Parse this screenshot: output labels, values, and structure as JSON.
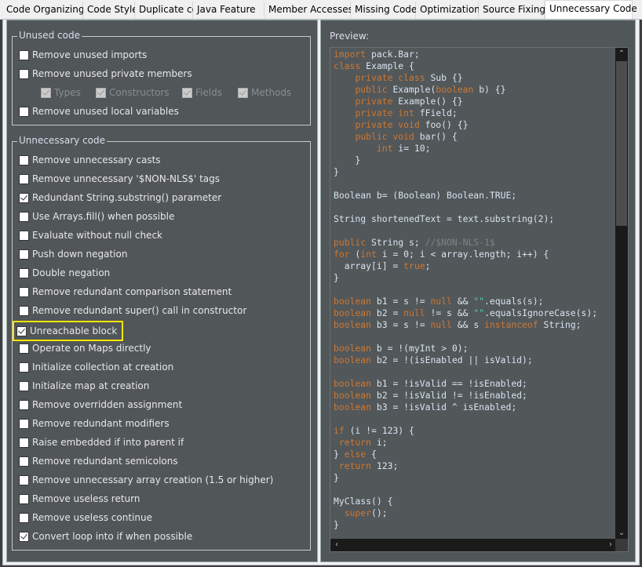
{
  "tabs": [
    {
      "label": "Code Organizing",
      "active": false
    },
    {
      "label": "Code Style",
      "active": false
    },
    {
      "label": "Duplicate code",
      "active": false
    },
    {
      "label": "Java Feature",
      "active": false
    },
    {
      "label": "Member Accesses",
      "active": false
    },
    {
      "label": "Missing Code",
      "active": false
    },
    {
      "label": "Optimization",
      "active": false
    },
    {
      "label": "Source Fixing",
      "active": false
    },
    {
      "label": "Unnecessary Code",
      "active": true
    }
  ],
  "unused_code": {
    "title": "Unused code",
    "options": [
      {
        "label": "Remove unused imports",
        "checked": false
      },
      {
        "label": "Remove unused private members",
        "checked": false
      }
    ],
    "sub_options": [
      {
        "label": "Types",
        "checked": true,
        "disabled": true
      },
      {
        "label": "Constructors",
        "checked": true,
        "disabled": true
      },
      {
        "label": "Fields",
        "checked": true,
        "disabled": true
      },
      {
        "label": "Methods",
        "checked": true,
        "disabled": true
      }
    ],
    "last_option": {
      "label": "Remove unused local variables",
      "checked": false
    }
  },
  "unnecessary_code": {
    "title": "Unnecessary code",
    "options": [
      {
        "label": "Remove unnecessary casts",
        "checked": false
      },
      {
        "label": "Remove unnecessary '$NON-NLS$' tags",
        "checked": false
      },
      {
        "label": "Redundant String.substring() parameter",
        "checked": true
      },
      {
        "label": "Use Arrays.fill() when possible",
        "checked": false
      },
      {
        "label": "Evaluate without null check",
        "checked": false
      },
      {
        "label": "Push down negation",
        "checked": false
      },
      {
        "label": "Double negation",
        "checked": false
      },
      {
        "label": "Remove redundant comparison statement",
        "checked": false
      },
      {
        "label": "Remove redundant super() call in constructor",
        "checked": false
      },
      {
        "label": "Unreachable block",
        "checked": true,
        "highlighted": true
      },
      {
        "label": "Operate on Maps directly",
        "checked": false
      },
      {
        "label": "Initialize collection at creation",
        "checked": false
      },
      {
        "label": "Initialize map at creation",
        "checked": false
      },
      {
        "label": "Remove overridden assignment",
        "checked": false
      },
      {
        "label": "Remove redundant modifiers",
        "checked": false
      },
      {
        "label": "Raise embedded if into parent if",
        "checked": false
      },
      {
        "label": "Remove redundant semicolons",
        "checked": false
      },
      {
        "label": "Remove unnecessary array creation (1.5 or higher)",
        "checked": false
      },
      {
        "label": "Remove useless return",
        "checked": false
      },
      {
        "label": "Remove useless continue",
        "checked": false
      },
      {
        "label": "Convert loop into if when possible",
        "checked": true
      }
    ]
  },
  "preview": {
    "label": "Preview:",
    "colors": {
      "keyword": "#cc7832",
      "text": "#d8e4f0",
      "comment": "#7f8385",
      "string": "#4ec9b0",
      "highlight": "#ffe600"
    },
    "lines": [
      [
        [
          "k",
          "import"
        ],
        [
          "t",
          " pack.Bar;"
        ]
      ],
      [
        [
          "k",
          "class"
        ],
        [
          "t",
          " Example {"
        ]
      ],
      [
        [
          "t",
          "    "
        ],
        [
          "k",
          "private class"
        ],
        [
          "t",
          " Sub {}"
        ]
      ],
      [
        [
          "t",
          "    "
        ],
        [
          "k",
          "public"
        ],
        [
          "t",
          " Example("
        ],
        [
          "k",
          "boolean"
        ],
        [
          "t",
          " b) {}"
        ]
      ],
      [
        [
          "t",
          "    "
        ],
        [
          "k",
          "private"
        ],
        [
          "t",
          " Example() {}"
        ]
      ],
      [
        [
          "t",
          "    "
        ],
        [
          "k",
          "private int"
        ],
        [
          "t",
          " fField;"
        ]
      ],
      [
        [
          "t",
          "    "
        ],
        [
          "k",
          "private void"
        ],
        [
          "t",
          " foo() {}"
        ]
      ],
      [
        [
          "t",
          "    "
        ],
        [
          "k",
          "public void"
        ],
        [
          "t",
          " bar() {"
        ]
      ],
      [
        [
          "t",
          "        "
        ],
        [
          "k",
          "int"
        ],
        [
          "t",
          " i= 10;"
        ]
      ],
      [
        [
          "t",
          "    }"
        ]
      ],
      [
        [
          "t",
          "}"
        ]
      ],
      [],
      [
        [
          "t",
          "Boolean b= (Boolean) Boolean.TRUE;"
        ]
      ],
      [],
      [
        [
          "t",
          "String shortenedText = text.substring(2);"
        ]
      ],
      [],
      [
        [
          "k",
          "public"
        ],
        [
          "t",
          " String s; "
        ],
        [
          "c",
          "//$NON-NLS-1$"
        ]
      ],
      [
        [
          "k",
          "for"
        ],
        [
          "t",
          " ("
        ],
        [
          "k",
          "int"
        ],
        [
          "t",
          " i = 0; i < array.length; i++) {"
        ]
      ],
      [
        [
          "t",
          "  array[i] = "
        ],
        [
          "k",
          "true"
        ],
        [
          "t",
          ";"
        ]
      ],
      [
        [
          "t",
          "}"
        ]
      ],
      [],
      [
        [
          "k",
          "boolean"
        ],
        [
          "t",
          " b1 = s != "
        ],
        [
          "k",
          "null"
        ],
        [
          "t",
          " && "
        ],
        [
          "s",
          "\"\""
        ],
        [
          "t",
          ".equals(s);"
        ]
      ],
      [
        [
          "k",
          "boolean"
        ],
        [
          "t",
          " b2 = "
        ],
        [
          "k",
          "null"
        ],
        [
          "t",
          " != s && "
        ],
        [
          "s",
          "\"\""
        ],
        [
          "t",
          ".equalsIgnoreCase(s);"
        ]
      ],
      [
        [
          "k",
          "boolean"
        ],
        [
          "t",
          " b3 = s != "
        ],
        [
          "k",
          "null"
        ],
        [
          "t",
          " && s "
        ],
        [
          "k",
          "instanceof"
        ],
        [
          "t",
          " String;"
        ]
      ],
      [],
      [
        [
          "k",
          "boolean"
        ],
        [
          "t",
          " b = !(myInt > 0);"
        ]
      ],
      [
        [
          "k",
          "boolean"
        ],
        [
          "t",
          " b2 = !(isEnabled || isValid);"
        ]
      ],
      [],
      [
        [
          "k",
          "boolean"
        ],
        [
          "t",
          " b1 = !isValid == !isEnabled;"
        ]
      ],
      [
        [
          "k",
          "boolean"
        ],
        [
          "t",
          " b2 = !isValid != !isEnabled;"
        ]
      ],
      [
        [
          "k",
          "boolean"
        ],
        [
          "t",
          " b3 = !isValid ^ isEnabled;"
        ]
      ],
      [],
      [
        [
          "k",
          "if"
        ],
        [
          "t",
          " (i != 123) {"
        ]
      ],
      [
        [
          "t",
          " "
        ],
        [
          "k",
          "return"
        ],
        [
          "t",
          " i;"
        ]
      ],
      [
        [
          "t",
          "} "
        ],
        [
          "k",
          "else"
        ],
        [
          "t",
          " {"
        ]
      ],
      [
        [
          "t",
          " "
        ],
        [
          "k",
          "return"
        ],
        [
          "t",
          " 123;"
        ]
      ],
      [
        [
          "t",
          "}"
        ]
      ],
      [],
      [
        [
          "t",
          "MyClass() {"
        ]
      ],
      [
        [
          "t",
          "  "
        ],
        [
          "k",
          "super"
        ],
        [
          "t",
          "();"
        ]
      ],
      [
        [
          "t",
          "}"
        ]
      ]
    ]
  }
}
